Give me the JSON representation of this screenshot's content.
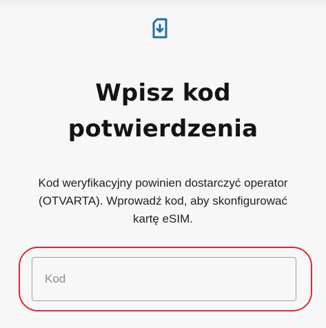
{
  "header": {
    "icon": "sim-card-download-icon",
    "accent_color": "#1f6faa"
  },
  "title": {
    "line1": "Wpisz kod",
    "line2": "potwierdzenia"
  },
  "description": "Kod weryfikacyjny powinien dostarczyć operator (OTVARTA). Wprowadź kod, aby skonfigurować kartę eSIM.",
  "code_field": {
    "placeholder": "Kod",
    "value": ""
  },
  "highlight_color": "#e0272f"
}
